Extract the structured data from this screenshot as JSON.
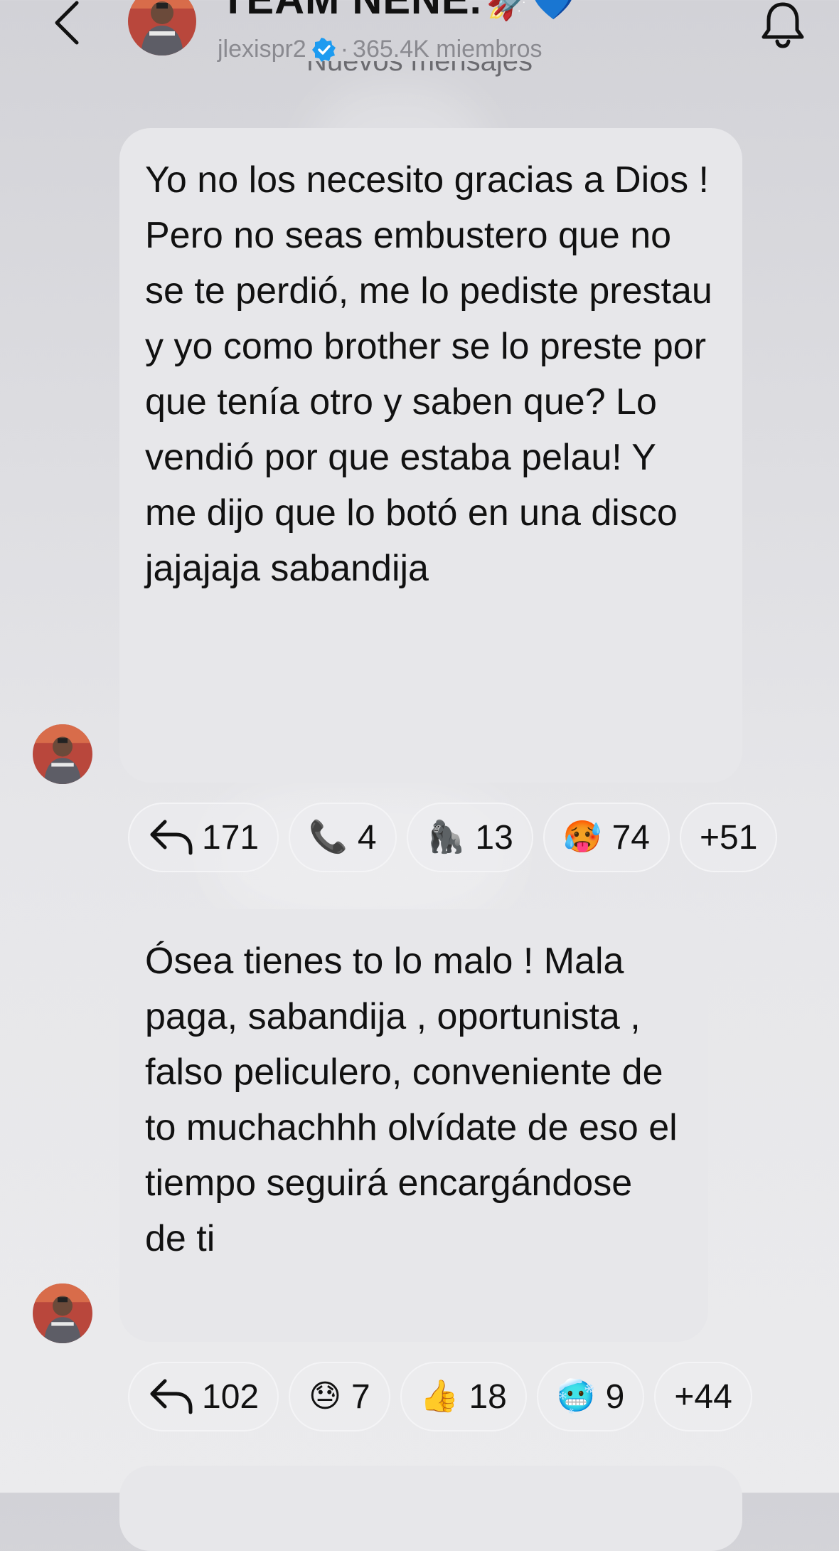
{
  "header": {
    "title": "TEAM NENE.",
    "title_emojis": "🚀💙",
    "username": "jlexisp r2",
    "username_display": "jlexispr2",
    "separator": "·",
    "members": "365.4K miembros"
  },
  "divider": {
    "new_messages": "Nuevos mensajes"
  },
  "messages": [
    {
      "text": "Yo no los necesito gracias a Dios ! Pero no seas embustero que no se te perdió, me lo pediste prestau y yo como brother se lo preste por que tenía otro y saben que? Lo vendió por que estaba pelau! Y me dijo que lo botó en una disco jajajaja sabandija",
      "reactions": [
        {
          "icon": "reply-icon",
          "emoji": "",
          "count": "171"
        },
        {
          "icon": "telephone-receiver-emoji",
          "emoji": "📞",
          "count": "4"
        },
        {
          "icon": "gorilla-emoji",
          "emoji": "🦍",
          "count": "13"
        },
        {
          "icon": "hot-face-emoji",
          "emoji": "🥵",
          "count": "74"
        },
        {
          "icon": "more-reactions",
          "emoji": "",
          "count": "+51"
        }
      ]
    },
    {
      "text": "Ósea tienes to lo malo ! Mala paga, sabandija , oportunista , falso peliculero, conveniente de to muchachhh olvídate de eso el tiempo seguirá encargándose de ti",
      "reactions": [
        {
          "icon": "reply-icon",
          "emoji": "",
          "count": "102"
        },
        {
          "icon": "downcast-sweat-emoji",
          "emoji": "😓",
          "count": "7"
        },
        {
          "icon": "thumbs-up-emoji",
          "emoji": "👍",
          "count": "18"
        },
        {
          "icon": "cold-face-emoji",
          "emoji": "🥶",
          "count": "9"
        },
        {
          "icon": "more-reactions",
          "emoji": "",
          "count": "+44"
        }
      ]
    }
  ],
  "colors": {
    "bubble": "#e7e7ea",
    "verified": "#1d9bf0",
    "subtext": "#8a8a90"
  }
}
